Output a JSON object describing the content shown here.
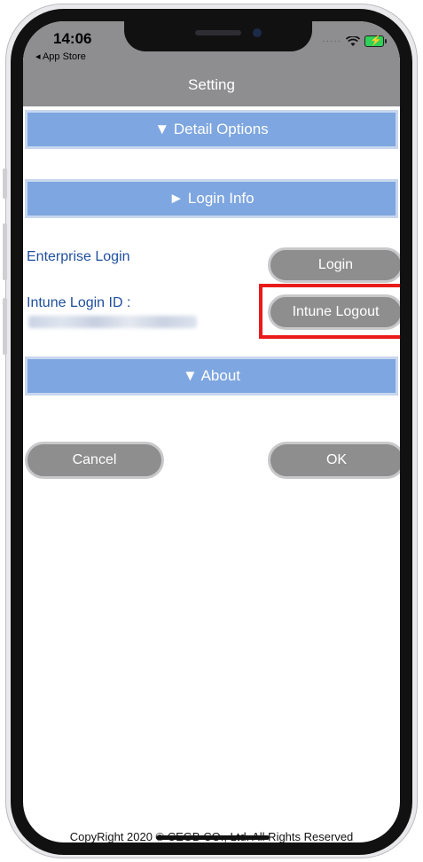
{
  "status_bar": {
    "time": "14:06",
    "back_label": "◂ App Store",
    "signal": "·····"
  },
  "header": {
    "title": "Setting"
  },
  "sections": {
    "detail_options": "▼ Detail Options",
    "login_info": "► Login Info",
    "about": "▼ About"
  },
  "login": {
    "enterprise_label": "Enterprise Login",
    "login_button": "Login",
    "intune_label": "Intune Login ID :",
    "logout_button": "Intune Logout"
  },
  "actions": {
    "cancel": "Cancel",
    "ok": "OK"
  },
  "footer": {
    "copyright": "CopyRight 2020 © CEGB CO., Ltd. All Rights Reserved"
  },
  "colors": {
    "section_blue": "#7ea6e0",
    "topbar_gray": "#8e8e90",
    "button_gray": "#8e8e8f",
    "label_blue": "#1f4f9e",
    "highlight_red": "#ea1a1a"
  }
}
